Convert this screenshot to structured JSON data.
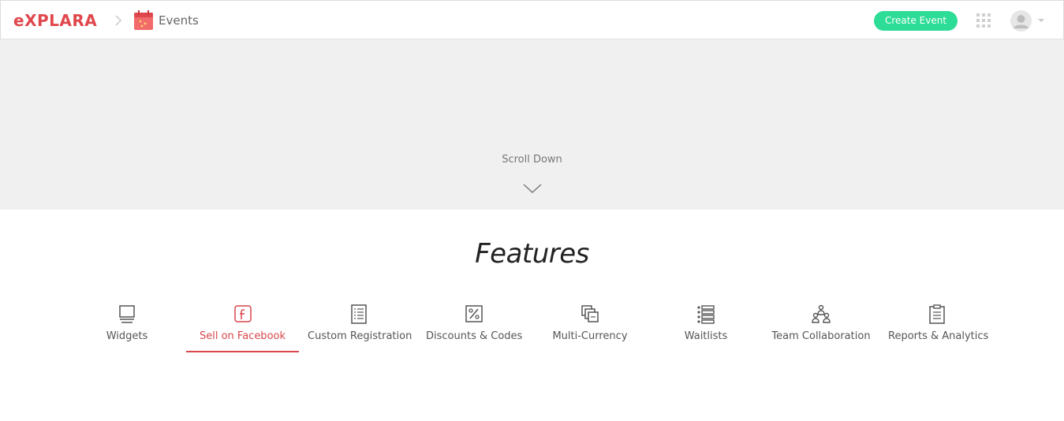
{
  "header": {
    "logo_text": "eXPLARA",
    "breadcrumb_label": "Events",
    "create_button_label": "Create Event",
    "icons": [
      "chevron-right-icon",
      "calendar-icon",
      "apps-grid-icon",
      "user-avatar-icon",
      "caret-down-icon"
    ]
  },
  "hero": {
    "scroll_label": "Scroll Down",
    "icon": "chevron-down-icon"
  },
  "features": {
    "title": "Features",
    "active_index": 1,
    "items": [
      {
        "label": "Widgets",
        "icon": "monitor-icon"
      },
      {
        "label": "Sell on Facebook",
        "icon": "facebook-icon"
      },
      {
        "label": "Custom Registration",
        "icon": "form-icon"
      },
      {
        "label": "Discounts & Codes",
        "icon": "percent-icon"
      },
      {
        "label": "Multi-Currency",
        "icon": "currency-icon"
      },
      {
        "label": "Waitlists",
        "icon": "list-icon"
      },
      {
        "label": "Team Collaboration",
        "icon": "team-icon"
      },
      {
        "label": "Reports & Analytics",
        "icon": "clipboard-icon"
      }
    ]
  },
  "colors": {
    "brand_red": "#e0474c",
    "create_button_green": "#2ddc96",
    "hero_background": "#f0f0f0",
    "active_tab": "#d9464b"
  }
}
